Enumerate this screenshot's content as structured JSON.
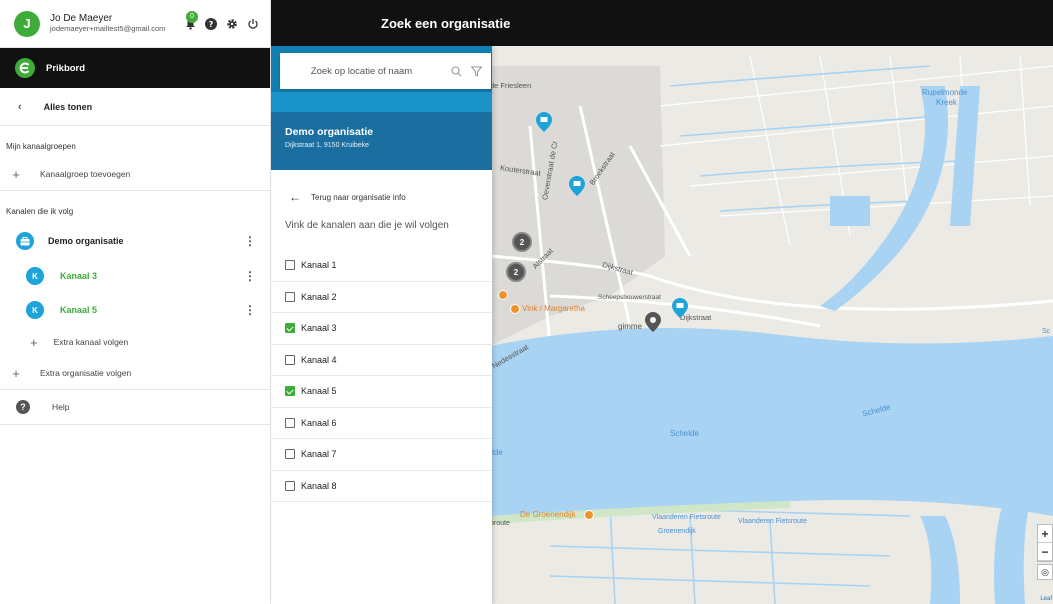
{
  "user": {
    "name": "Jo De Maeyer",
    "email": "jodemaeyer+mailtest5@gmail.com",
    "avatar_letter": "J",
    "notification_count": "0"
  },
  "brand": {
    "label": "Prikbord"
  },
  "nav": {
    "show_all": "Alles tonen",
    "my_groups_label": "Mijn kanaalgroepen",
    "add_group": "Kanaalgroep toevoegen",
    "following_label": "Kanalen die ik volg",
    "organisation": "Demo organisatie",
    "channels": [
      {
        "badge": "K",
        "label": "Kanaal 3"
      },
      {
        "badge": "K",
        "label": "Kanaal 5"
      }
    ],
    "extra_channel": "Extra kanaal volgen",
    "extra_org": "Extra organisatie volgen",
    "help": "Help"
  },
  "topbar": {
    "title": "Zoek een organisatie"
  },
  "search": {
    "placeholder": "Zoek op locatie of naam"
  },
  "org": {
    "name": "Demo organisatie",
    "address": "Dijkstraat 1, 9150 Kruibeke"
  },
  "panel": {
    "back_label": "Terug naar organisatie info",
    "instruction": "Vink de kanalen aan die je wil volgen",
    "channels": [
      {
        "label": "Kanaal 1",
        "checked": false
      },
      {
        "label": "Kanaal 2",
        "checked": false
      },
      {
        "label": "Kanaal 3",
        "checked": true
      },
      {
        "label": "Kanaal 4",
        "checked": false
      },
      {
        "label": "Kanaal 5",
        "checked": true
      },
      {
        "label": "Kanaal 6",
        "checked": false
      },
      {
        "label": "Kanaal 7",
        "checked": false
      },
      {
        "label": "Kanaal 8",
        "checked": false
      }
    ]
  },
  "map": {
    "labels": {
      "friesleen": "de Friesleen",
      "rupelmonde": "Rupelmonde",
      "kreek": "Kreek",
      "kouterstraat": "Kouterstraat",
      "oeverstraat": "Oeverstraat de Cr",
      "broekstraat": "Broekstraat",
      "dijkstraat": "Dijkstraat",
      "dijkstraat2": "Dijkstraat",
      "scheepsbouwerstraat": "Scheepsbouwerstraat",
      "alstraat": "Alstraat",
      "nedesstraat": "Nedesstraat",
      "vink": "Vink / Margaretha",
      "gimme": "gimme",
      "scheldeA": "Schelde",
      "scheldeB": "Schelde",
      "scheldeC": "lde",
      "groenendijk_poi": "De Groenendijk",
      "fietsroute1": "Vlaanderen Fietsroute",
      "fietsroute2": "Vlaanderen Fietsroute",
      "groenendijk": "Groenendijk",
      "sc": "Sc",
      "broute": "broute"
    },
    "clusters": [
      "2",
      "2"
    ],
    "zoom_in": "+",
    "zoom_out": "−",
    "attribution": "Leaf"
  },
  "colors": {
    "brand_green": "#3fab38",
    "accent_blue": "#1ea4d9",
    "hero_blue": "#127fb3",
    "water": "#a9d3f2"
  }
}
